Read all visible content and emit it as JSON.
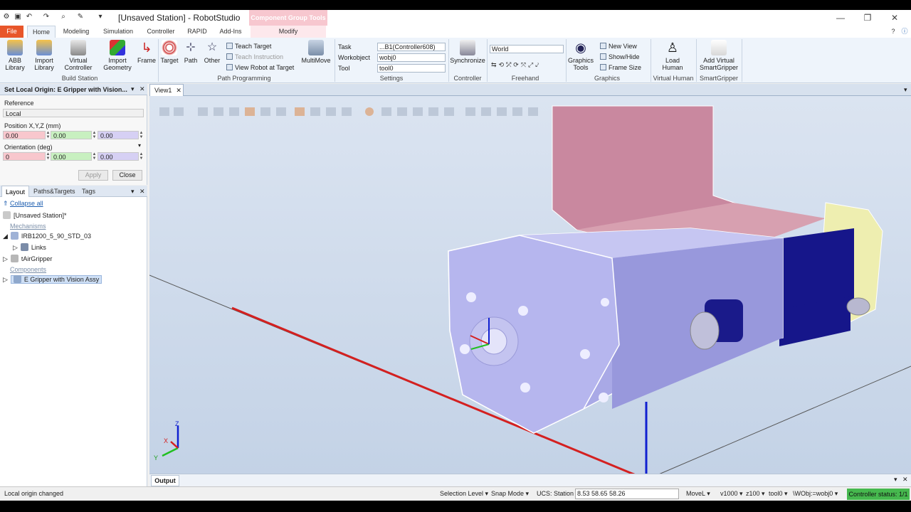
{
  "window": {
    "title": "[Unsaved Station] - RobotStudio",
    "context_tab": "Component Group Tools"
  },
  "menu_tabs": [
    "File",
    "Home",
    "Modeling",
    "Simulation",
    "Controller",
    "RAPID",
    "Add-Ins",
    "Modify"
  ],
  "ribbon": {
    "build_station": {
      "label": "Build Station",
      "abb_library": "ABB\nLibrary",
      "import_library": "Import\nLibrary",
      "virtual_controller": "Virtual\nController",
      "import_geometry": "Import\nGeometry",
      "frame": "Frame"
    },
    "path_programming": {
      "label": "Path Programming",
      "target": "Target",
      "path": "Path",
      "other": "Other",
      "teach_target": "Teach Target",
      "teach_instruction": "Teach Instruction",
      "view_robot_at_target": "View Robot at Target",
      "multimove": "MultiMove"
    },
    "settings": {
      "label": "Settings",
      "task_label": "Task",
      "task_value": "...B1(Controller608)",
      "workobject_label": "Workobject",
      "workobject_value": "wobj0",
      "tool_label": "Tool",
      "tool_value": "tool0"
    },
    "controller": {
      "label": "Controller",
      "synchronize": "Synchronize"
    },
    "freehand": {
      "label": "Freehand",
      "reference_value": "World"
    },
    "graphics": {
      "label": "Graphics",
      "graphics_tools": "Graphics\nTools",
      "new_view": "New View",
      "show_hide": "Show/Hide",
      "frame_size": "Frame Size"
    },
    "virtual_human": {
      "label": "Virtual Human",
      "load_human": "Load\nHuman"
    },
    "smartgripper": {
      "label": "SmartGripper",
      "add_virtual": "Add Virtual\nSmartGripper"
    }
  },
  "local_origin_panel": {
    "title": "Set Local Origin: E Gripper with Vision...",
    "reference_label": "Reference",
    "reference_value": "Local",
    "position_label": "Position X,Y,Z (mm)",
    "position": [
      "0.00",
      "0.00",
      "0.00"
    ],
    "orientation_label": "Orientation (deg)",
    "orientation": [
      "0",
      "0.00",
      "0.00"
    ],
    "apply": "Apply",
    "close": "Close"
  },
  "layout_panel": {
    "tabs": [
      "Layout",
      "Paths&Targets",
      "Tags"
    ],
    "collapse_all": "Collapse all",
    "station": "[Unsaved Station]*",
    "mechanisms_group": "Mechanisms",
    "robot": "IRB1200_5_90_STD_03",
    "links": "Links",
    "tool": "tAirGripper",
    "components_group": "Components",
    "component": "E Gripper with Vision Assy"
  },
  "view": {
    "tab": "View1",
    "axis_x": "X",
    "axis_y": "Y",
    "axis_z": "Z"
  },
  "output": {
    "tab": "Output"
  },
  "status": {
    "message": "Local origin changed",
    "selection_level": "Selection Level",
    "snap_mode": "Snap Mode",
    "ucs": "UCS: Station",
    "coords": "8.53  58.65  58.26",
    "movel": "MoveL",
    "speed": "v1000",
    "zone": "z100",
    "tool": "tool0",
    "wobj": "\\WObj:=wobj0",
    "controller_status": "Controller status: 1/1"
  },
  "colors": {
    "accent_file": "#e8562a",
    "context_tab": "#f7c7cf",
    "controller_ok": "#46b84e",
    "gripper_body": "#a8a8e8",
    "bracket": "#c6869c",
    "dark_block": "#1a1a8a",
    "yellow_part": "#f0f0b0"
  }
}
